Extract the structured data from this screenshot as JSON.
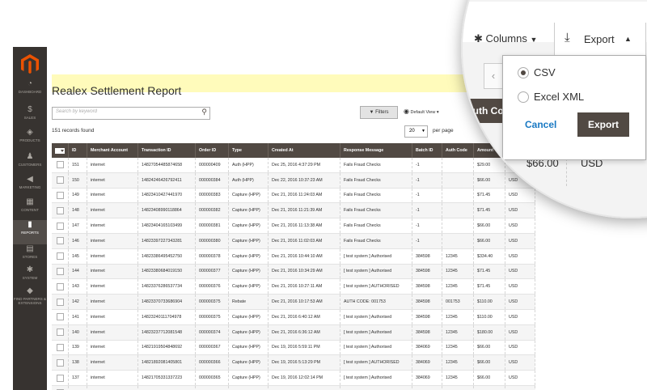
{
  "sidebar": {
    "items": [
      {
        "label": "DASHBOARD",
        "icon": "dashboard-icon",
        "glyph": "◔"
      },
      {
        "label": "SALES",
        "icon": "dollar-icon",
        "glyph": "$"
      },
      {
        "label": "PRODUCTS",
        "icon": "cube-icon",
        "glyph": "◈"
      },
      {
        "label": "CUSTOMERS",
        "icon": "person-icon",
        "glyph": "♟"
      },
      {
        "label": "MARKETING",
        "icon": "megaphone-icon",
        "glyph": "◀"
      },
      {
        "label": "CONTENT",
        "icon": "layout-icon",
        "glyph": "▦"
      },
      {
        "label": "REPORTS",
        "icon": "bar-chart-icon",
        "glyph": "▮"
      },
      {
        "label": "STORES",
        "icon": "store-icon",
        "glyph": "▤"
      },
      {
        "label": "SYSTEM",
        "icon": "gear-icon",
        "glyph": "✱"
      },
      {
        "label": "FIND PARTNERS & EXTENSIONS",
        "icon": "puzzle-icon",
        "glyph": "◆"
      }
    ]
  },
  "page": {
    "title": "Realex Settlement Report",
    "search_placeholder": "Search by keyword",
    "filters_label": "Filters",
    "view_label": "Default View",
    "records_found": "151 records found",
    "per_page_value": "20",
    "per_page_label": "per page"
  },
  "table": {
    "headers": [
      "ID",
      "Merchant Account",
      "Transaction ID",
      "Order ID",
      "Type",
      "Created At",
      "Response Message",
      "Batch ID",
      "Auth Code",
      "Amount",
      "Currency"
    ],
    "rows": [
      [
        "151",
        "internet",
        "14827054485874658",
        "000000409",
        "Auth (HPP)",
        "Dec 25, 2016 4:37:29 PM",
        "Fails Fraud Checks",
        "-1",
        "",
        "$29.00",
        "USD"
      ],
      [
        "150",
        "internet",
        "14824246426792411",
        "000000384",
        "Auth (HPP)",
        "Dec 22, 2016 10:37:23 AM",
        "Fails Fraud Checks",
        "-1",
        "",
        "$66.00",
        "USD"
      ],
      [
        "149",
        "internet",
        "14823410427441970",
        "000000383",
        "Capture (HPP)",
        "Dec 21, 2016 11:24:03 AM",
        "Fails Fraud Checks",
        "-1",
        "",
        "$71.45",
        "USD"
      ],
      [
        "148",
        "internet",
        "14823408990118864",
        "000000382",
        "Capture (HPP)",
        "Dec 21, 2016 11:21:39 AM",
        "Fails Fraud Checks",
        "-1",
        "",
        "$71.45",
        "USD"
      ],
      [
        "147",
        "internet",
        "14823404165103499",
        "000000381",
        "Capture (HPP)",
        "Dec 21, 2016 11:13:38 AM",
        "Fails Fraud Checks",
        "-1",
        "",
        "$66.00",
        "USD"
      ],
      [
        "146",
        "internet",
        "14823397227343281",
        "000000380",
        "Capture (HPP)",
        "Dec 21, 2016 11:02:03 AM",
        "Fails Fraud Checks",
        "-1",
        "",
        "$66.00",
        "USD"
      ],
      [
        "145",
        "internet",
        "14823386495452750",
        "000000378",
        "Capture (HPP)",
        "Dec 21, 2016 10:44:10 AM",
        "[ test system ] Authorised",
        "384598",
        "12345",
        "$334.40",
        "USD"
      ],
      [
        "144",
        "internet",
        "14823380684019150",
        "000000377",
        "Capture (HPP)",
        "Dec 21, 2016 10:34:29 AM",
        "[ test system ] Authorised",
        "384598",
        "12345",
        "$71.45",
        "USD"
      ],
      [
        "143",
        "internet",
        "14823376286537734",
        "000000376",
        "Capture (HPP)",
        "Dec 21, 2016 10:27:11 AM",
        "[ test system ] AUTHORISED",
        "384598",
        "12345",
        "$71.45",
        "USD"
      ],
      [
        "142",
        "internet",
        "14823370733686904",
        "000000375",
        "Rebate",
        "Dec 21, 2016 10:17:53 AM",
        "AUTH CODE: 001753",
        "384598",
        "001753",
        "$110.00",
        "USD"
      ],
      [
        "141",
        "internet",
        "14823240111704978",
        "000000375",
        "Capture (HPP)",
        "Dec 21, 2016 6:40:12 AM",
        "[ test system ] Authorised",
        "384598",
        "12345",
        "$110.00",
        "USD"
      ],
      [
        "140",
        "internet",
        "14823237712081548",
        "000000374",
        "Capture (HPP)",
        "Dec 21, 2016 6:36:12 AM",
        "[ test system ] Authorised",
        "384598",
        "12345",
        "$180.00",
        "USD"
      ],
      [
        "139",
        "internet",
        "14821919504848692",
        "000000367",
        "Capture (HPP)",
        "Dec 19, 2016 5:59:11 PM",
        "[ test system ] Authorised",
        "384069",
        "12345",
        "$66.00",
        "USD"
      ],
      [
        "138",
        "internet",
        "14821892081405801",
        "000000366",
        "Capture (HPP)",
        "Dec 19, 2016 5:13:29 PM",
        "[ test system ] AUTHORISED",
        "384069",
        "12345",
        "$66.00",
        "USD"
      ],
      [
        "137",
        "internet",
        "14821705331337223",
        "000000365",
        "Capture (HPP)",
        "Dec 19, 2016 12:02:14 PM",
        "[ test system ] Authorised",
        "384069",
        "12345",
        "$66.00",
        "USD"
      ],
      [
        "136",
        "3dsecure",
        "14821703852682995",
        "000000363",
        "Capture (HPP)",
        "Dec 19, 2016 11:59:46 AM",
        "[ test system ] Authorised",
        "384069",
        "12345",
        "$66.00",
        "USD"
      ]
    ]
  },
  "zoom": {
    "columns_label": "Columns",
    "export_label": "Export",
    "options": [
      "CSV",
      "Excel XML"
    ],
    "selected_option": "CSV",
    "cancel_label": "Cancel",
    "export_button_label": "Export",
    "auth_code_label": "Auth Cod",
    "amount": "$66.00",
    "currency": "USD"
  },
  "colors": {
    "sidebar": "#373330",
    "header_dark": "#514943",
    "notice": "#fffbbb",
    "link": "#1979c3"
  }
}
